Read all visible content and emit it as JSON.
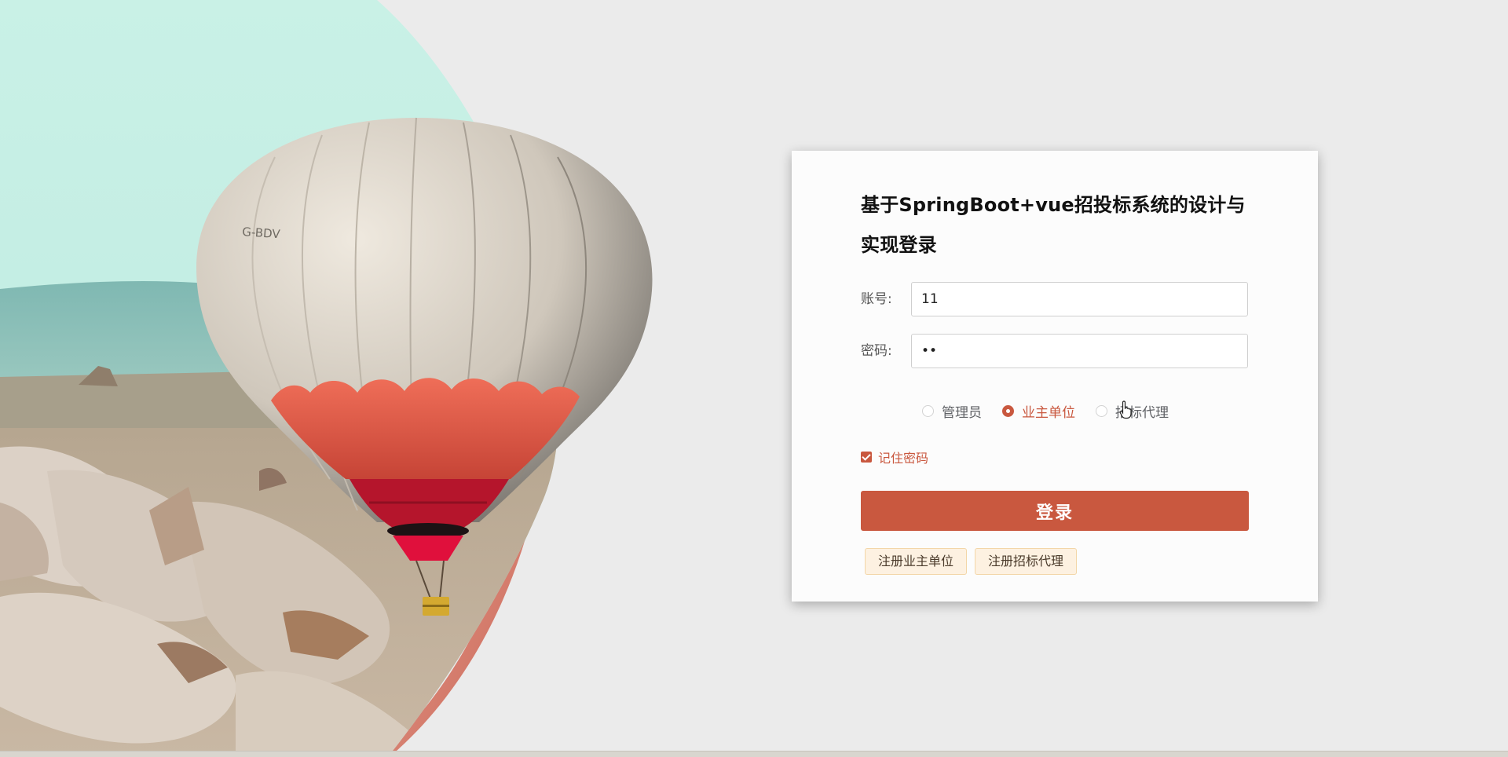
{
  "hero": {
    "balloon_registration": "G-BDV"
  },
  "login": {
    "title": "基于SpringBoot+vue招投标系统的设计与实现登录",
    "account_label": "账号:",
    "account_value": "11",
    "password_label": "密码:",
    "password_value": "11",
    "roles": [
      {
        "label": "管理员",
        "selected": false
      },
      {
        "label": "业主单位",
        "selected": true
      },
      {
        "label": "招标代理",
        "selected": false
      }
    ],
    "remember_label": "记住密码",
    "remember_checked": true,
    "login_button": "登录",
    "register_owner_button": "注册业主单位",
    "register_agent_button": "注册招标代理"
  },
  "colors": {
    "accent": "#c9583f",
    "page_background": "#ebebeb",
    "card_background": "#fcfcfc",
    "register_button_bg": "#fdf1e1",
    "register_button_border": "#f3d6a8"
  },
  "icons": {
    "cursor": "hand-pointer-icon",
    "checkbox": "check-icon"
  }
}
